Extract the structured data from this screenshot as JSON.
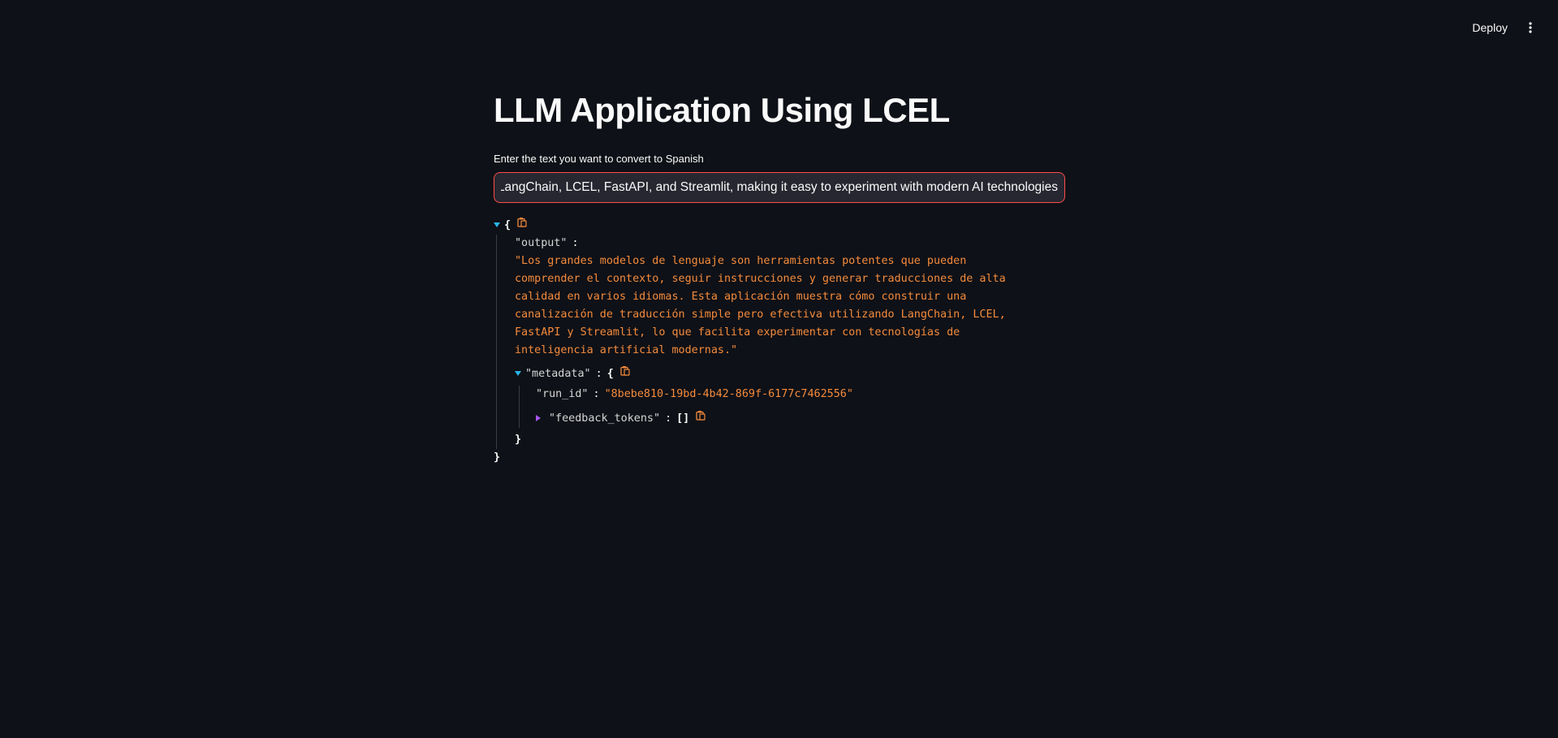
{
  "toolbar": {
    "deploy_label": "Deploy",
    "menu_icon": "vertical-ellipsis-icon"
  },
  "main": {
    "title": "LLM Application Using LCEL",
    "input_label": "Enter the text you want to convert to Spanish",
    "input_value": "ng LangChain, LCEL, FastAPI, and Streamlit, making it easy to experiment with modern AI technologies."
  },
  "json_view": {
    "open_brace": "{",
    "close_brace": "}",
    "output_key": "\"output\"",
    "colon": ":",
    "output_value": "\"Los grandes modelos de lenguaje son herramientas potentes que pueden comprender el contexto, seguir instrucciones y generar traducciones de alta calidad en varios idiomas. Esta aplicación muestra cómo construir una canalización de traducción simple pero efectiva utilizando LangChain, LCEL, FastAPI y Streamlit, lo que facilita experimentar con tecnologías de inteligencia artificial modernas.\"",
    "metadata_key": "\"metadata\"",
    "run_id_key": "\"run_id\"",
    "run_id_value": "\"8bebe810-19bd-4b42-869f-6177c7462556\"",
    "feedback_tokens_key": "\"feedback_tokens\"",
    "feedback_tokens_value": "[]",
    "copy_icon": "clipboard-icon"
  },
  "colors": {
    "background": "#0e1117",
    "input_border": "#ff4b4b",
    "string_value": "#f58b3c",
    "caret_open": "#29b5e8",
    "caret_closed": "#a855f7"
  }
}
